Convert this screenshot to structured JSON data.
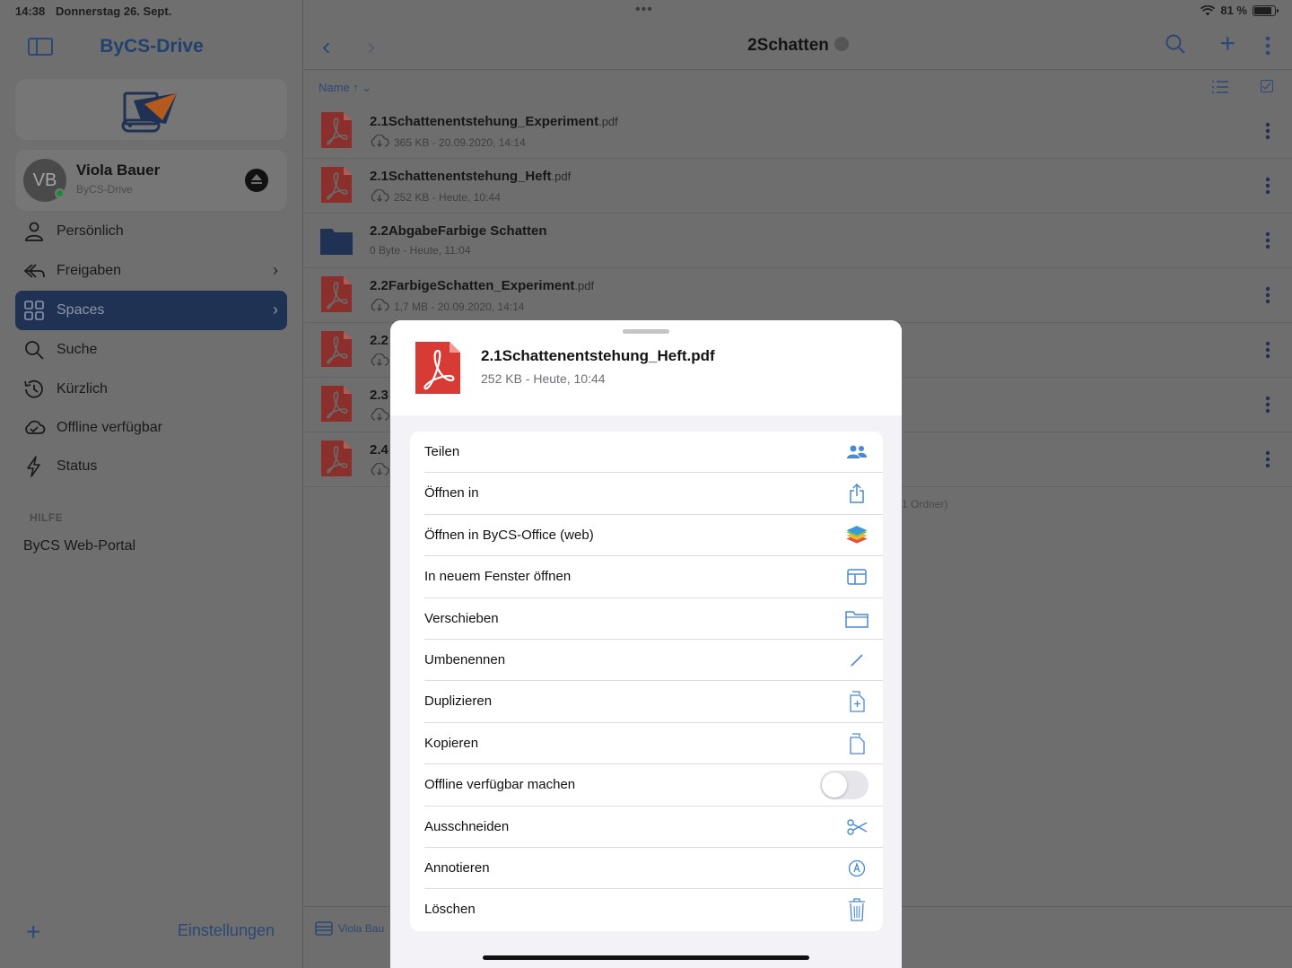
{
  "status_bar": {
    "time": "14:38",
    "date": "Donnerstag 26. Sept.",
    "battery": "81 %",
    "multitask_dots": "•••"
  },
  "sidebar": {
    "app_title": "ByCS-Drive",
    "account": {
      "initials": "VB",
      "name": "Viola Bauer",
      "subtitle": "ByCS-Drive"
    },
    "items": [
      {
        "label": "Persönlich",
        "icon": "person-icon"
      },
      {
        "label": "Freigaben",
        "icon": "share-icon",
        "chevron": "›"
      },
      {
        "label": "Spaces",
        "icon": "grid-icon",
        "chevron": "›",
        "active": true
      },
      {
        "label": "Suche",
        "icon": "search-icon"
      },
      {
        "label": "Kürzlich",
        "icon": "history-icon"
      },
      {
        "label": "Offline verfügbar",
        "icon": "cloud-check-icon"
      },
      {
        "label": "Status",
        "icon": "bolt-icon"
      }
    ],
    "help_header": "HILFE",
    "portal_link": "ByCS Web-Portal",
    "add_label": "+",
    "settings_label": "Einstellungen"
  },
  "main": {
    "title": "2Schatten",
    "sort_label": "Name ↑",
    "files": [
      {
        "name": "2.1Schattenentstehung_Experiment",
        "ext": ".pdf",
        "meta": "365 KB - 20.09.2020, 14:14",
        "type": "pdf",
        "cloud": true
      },
      {
        "name": "2.1Schattenentstehung_Heft",
        "ext": ".pdf",
        "meta": "252 KB - Heute, 10:44",
        "type": "pdf",
        "cloud": true
      },
      {
        "name": "2.2AbgabeFarbige Schatten",
        "ext": "",
        "meta": "0 Byte - Heute, 11:04",
        "type": "folder",
        "cloud": false
      },
      {
        "name": "2.2FarbigeSchatten_Experiment",
        "ext": ".pdf",
        "meta": "1,7 MB - 20.09.2020, 14:14",
        "type": "pdf",
        "cloud": true
      },
      {
        "name": "2.2",
        "ext": "",
        "meta": "",
        "type": "pdf",
        "cloud": true
      },
      {
        "name": "2.3",
        "ext": "",
        "meta": "",
        "type": "pdf",
        "cloud": true
      },
      {
        "name": "2.4",
        "ext": "",
        "meta": "",
        "type": "pdf",
        "cloud": true
      }
    ],
    "footer_summary": "1 Ordner)",
    "bottom_account": "Viola Bau"
  },
  "sheet": {
    "file_name": "2.1Schattenentstehung_Heft.pdf",
    "file_meta": "252 KB - Heute, 10:44",
    "actions": [
      {
        "label": "Teilen",
        "icon": "people-icon"
      },
      {
        "label": "Öffnen in",
        "icon": "share-out-icon"
      },
      {
        "label": "Öffnen in ByCS-Office (web)",
        "icon": "office-layers-icon"
      },
      {
        "label": "In neuem Fenster öffnen",
        "icon": "window-icon"
      },
      {
        "label": "Verschieben",
        "icon": "folder-icon"
      },
      {
        "label": "Umbenennen",
        "icon": "pencil-icon"
      },
      {
        "label": "Duplizieren",
        "icon": "duplicate-icon"
      },
      {
        "label": "Kopieren",
        "icon": "copy-icon"
      },
      {
        "label": "Offline verfügbar machen",
        "icon": "toggle",
        "toggle_on": false
      },
      {
        "label": "Ausschneiden",
        "icon": "scissors-icon"
      },
      {
        "label": "Annotieren",
        "icon": "annotate-icon"
      },
      {
        "label": "Löschen",
        "icon": "trash-icon"
      }
    ]
  },
  "colors": {
    "accent": "#2b4876",
    "pdf_red": "#d83a34",
    "sheet_icon_blue": "#4a89d4"
  }
}
